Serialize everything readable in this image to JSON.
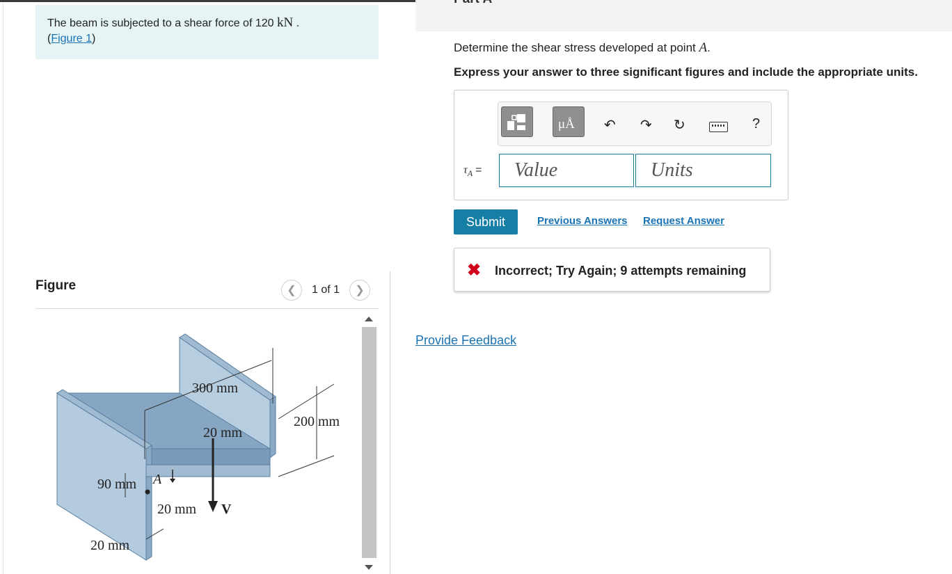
{
  "problem": {
    "text_before": "The beam is subjected to a shear force of 120",
    "unit": "kN",
    "text_after": " .",
    "figure_link": "Figure 1"
  },
  "figure_panel": {
    "title": "Figure",
    "pager_text": "1 of 1",
    "labels": {
      "top_width": "300 mm",
      "height": "200 mm",
      "web_thickness": "20 mm",
      "point_a": "A",
      "point_a_dist": "90 mm",
      "flange_thickness": "20 mm",
      "bottom_thickness": "20 mm",
      "shear_label": "V"
    }
  },
  "part": {
    "title": "Part A",
    "question_before": "Determine the shear stress developed at point ",
    "question_var": "A",
    "question_after": ".",
    "instruction": "Express your answer to three significant figures and include the appropriate units."
  },
  "answer": {
    "symbol": "τ",
    "subscript": "A",
    "equals": "=",
    "value_placeholder": "Value",
    "units_placeholder": "Units",
    "toolbar_units_glyph": "μÅ",
    "help_glyph": "?"
  },
  "actions": {
    "submit": "Submit",
    "previous_answers": "Previous Answers",
    "request_answer": "Request Answer"
  },
  "feedback": {
    "message": "Incorrect; Try Again; 9 attempts remaining",
    "status_color": "#d0021b"
  },
  "provide_feedback": "Provide Feedback",
  "colors": {
    "accent": "#177fa5",
    "link": "#1a73b5",
    "prompt_bg": "#e6f4f6",
    "beam": "#a9c4d8"
  }
}
